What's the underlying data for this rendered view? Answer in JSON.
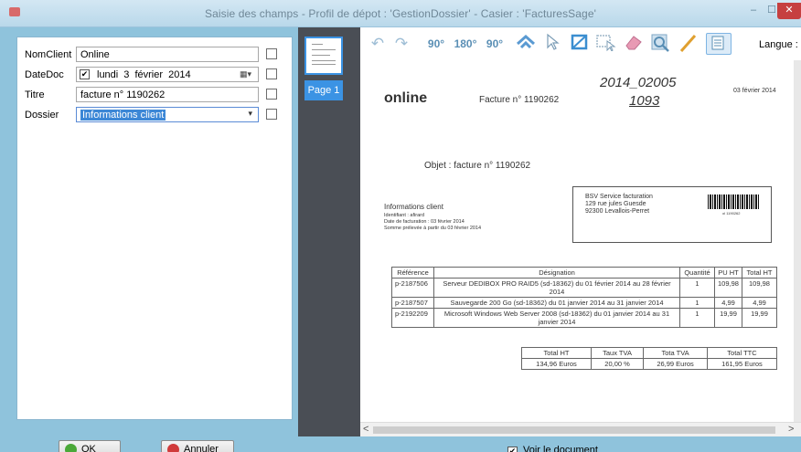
{
  "window": {
    "title": "Saisie des champs - Profil de dépot : 'GestionDossier' - Casier : 'FacturesSage'",
    "min": "–",
    "max": "☐",
    "close": "✕"
  },
  "fields": {
    "nomclient": {
      "label": "NomClient",
      "value": "Online"
    },
    "datedoc": {
      "label": "DateDoc",
      "checked": "✔",
      "value": "lundi 3 février 2014",
      "picker": "▦▾"
    },
    "titre": {
      "label": "Titre",
      "value": "facture n° 1190262"
    },
    "dossier": {
      "label": "Dossier",
      "value": "Informations client",
      "dropdown": "▾"
    }
  },
  "thumbs": {
    "page_label": "Page 1"
  },
  "toolbar": {
    "undo": "↶",
    "redo": "↷",
    "rot90": "90°",
    "rot180": "180°",
    "rotm90": "90°",
    "crop": "⬚",
    "langue_label": "Langue :"
  },
  "doc": {
    "logo": "online",
    "facture_header": "Facture n° 1190262",
    "date_right": "03 février 2014",
    "hand1": "2014_02005",
    "hand2": "1093",
    "objet": "Objet : facture n° 1190262",
    "client_title": "Informations client",
    "client_l1": "Identifiant :          afirard",
    "client_l2": "Date de facturation : 03 février 2014",
    "client_l3": "Somme prélevée à partir du 03 février 2014",
    "addr1": "BSV Service facturation",
    "addr2": "129 rue jules Guesde",
    "addr3": "92300 Levallois-Perret",
    "barcode_num": "ol 1190262",
    "table_headers": [
      "Référence",
      "Désignation",
      "Quantité",
      "PU HT",
      "Total HT"
    ],
    "rows": [
      [
        "p-2187506",
        "Serveur DEDIBOX PRO RAID5 (sd-18362) du 01 février 2014 au 28 février 2014",
        "1",
        "109,98",
        "109,98"
      ],
      [
        "p-2187507",
        "Sauvegarde 200 Go (sd-18362) du 01 janvier 2014 au 31 janvier 2014",
        "1",
        "4,99",
        "4,99"
      ],
      [
        "p-2192209",
        "Microsoft Windows Web Server 2008 (sd-18362) du 01 janvier 2014 au 31 janvier 2014",
        "1",
        "19,99",
        "19,99"
      ]
    ],
    "totals_headers": [
      "Total HT",
      "Taux TVA",
      "Tota TVA",
      "Total TTC"
    ],
    "totals_values": [
      "134,96 Euros",
      "20,00 %",
      "26,99 Euros",
      "161,95 Euros"
    ]
  },
  "bottom": {
    "ok_label": "OK",
    "cancel_label": "Annuler",
    "voir_label": "Voir le document",
    "voir_checked": "✔"
  },
  "scroll": {
    "left": "<",
    "right": ">"
  }
}
